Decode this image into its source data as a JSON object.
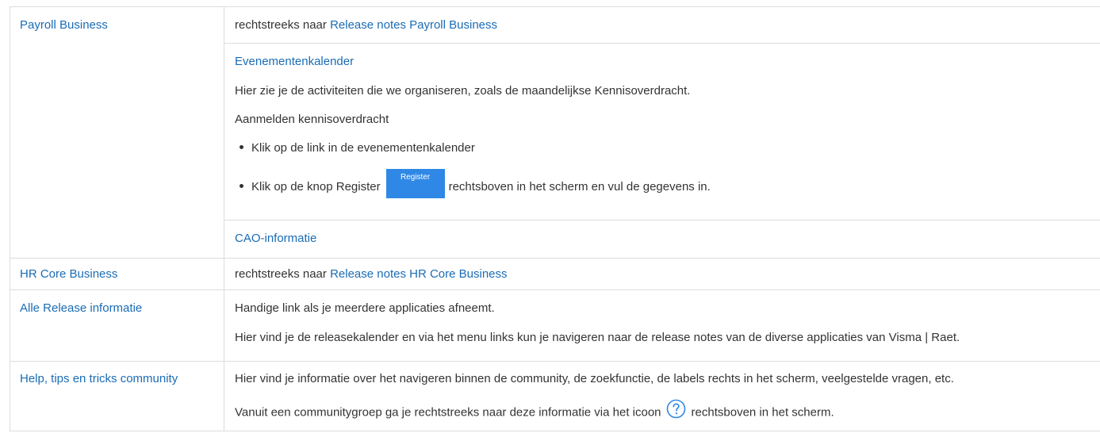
{
  "rows": {
    "payroll": {
      "label": "Payroll Business",
      "intro_prefix": "rechtstreeks naar ",
      "intro_link": "Release notes Payroll Business",
      "events_link": "Evenementenkalender",
      "events_desc": "Hier zie je de activiteiten die we organiseren, zoals de maandelijkse Kennisoverdracht.",
      "signup_title": "Aanmelden kennisoverdracht",
      "bullet1": "Klik op de link in de evenementenkalender",
      "bullet2_prefix": "Klik op de knop Register",
      "register_button": "Register",
      "bullet2_suffix": "rechtsboven in het scherm en vul de gegevens in.",
      "cao_link": "CAO-informatie"
    },
    "hrcore": {
      "label": "HR Core Business",
      "intro_prefix": "rechtstreeks naar ",
      "intro_link": "Release notes HR Core Business"
    },
    "release": {
      "label": "Alle Release informatie",
      "line1": "Handige link als je meerdere applicaties afneemt.",
      "line2": "Hier vind je de releasekalender en via het menu links kun je navigeren naar de release notes van de diverse applicaties van Visma | Raet."
    },
    "help": {
      "label": "Help, tips en tricks community",
      "line1": "Hier vind je informatie over het navigeren binnen de community, de zoekfunctie, de labels rechts in het scherm, veelgestelde vragen, etc.",
      "line2_prefix": "Vanuit een communitygroep ga je rechtstreeks naar deze informatie via het icoon",
      "help_icon": "question-circle-icon",
      "line2_suffix": "rechtsboven in het scherm."
    }
  },
  "colors": {
    "link": "#1a6cb5",
    "text": "#333333",
    "border": "#dcdcdc",
    "button": "#2f88e6"
  }
}
